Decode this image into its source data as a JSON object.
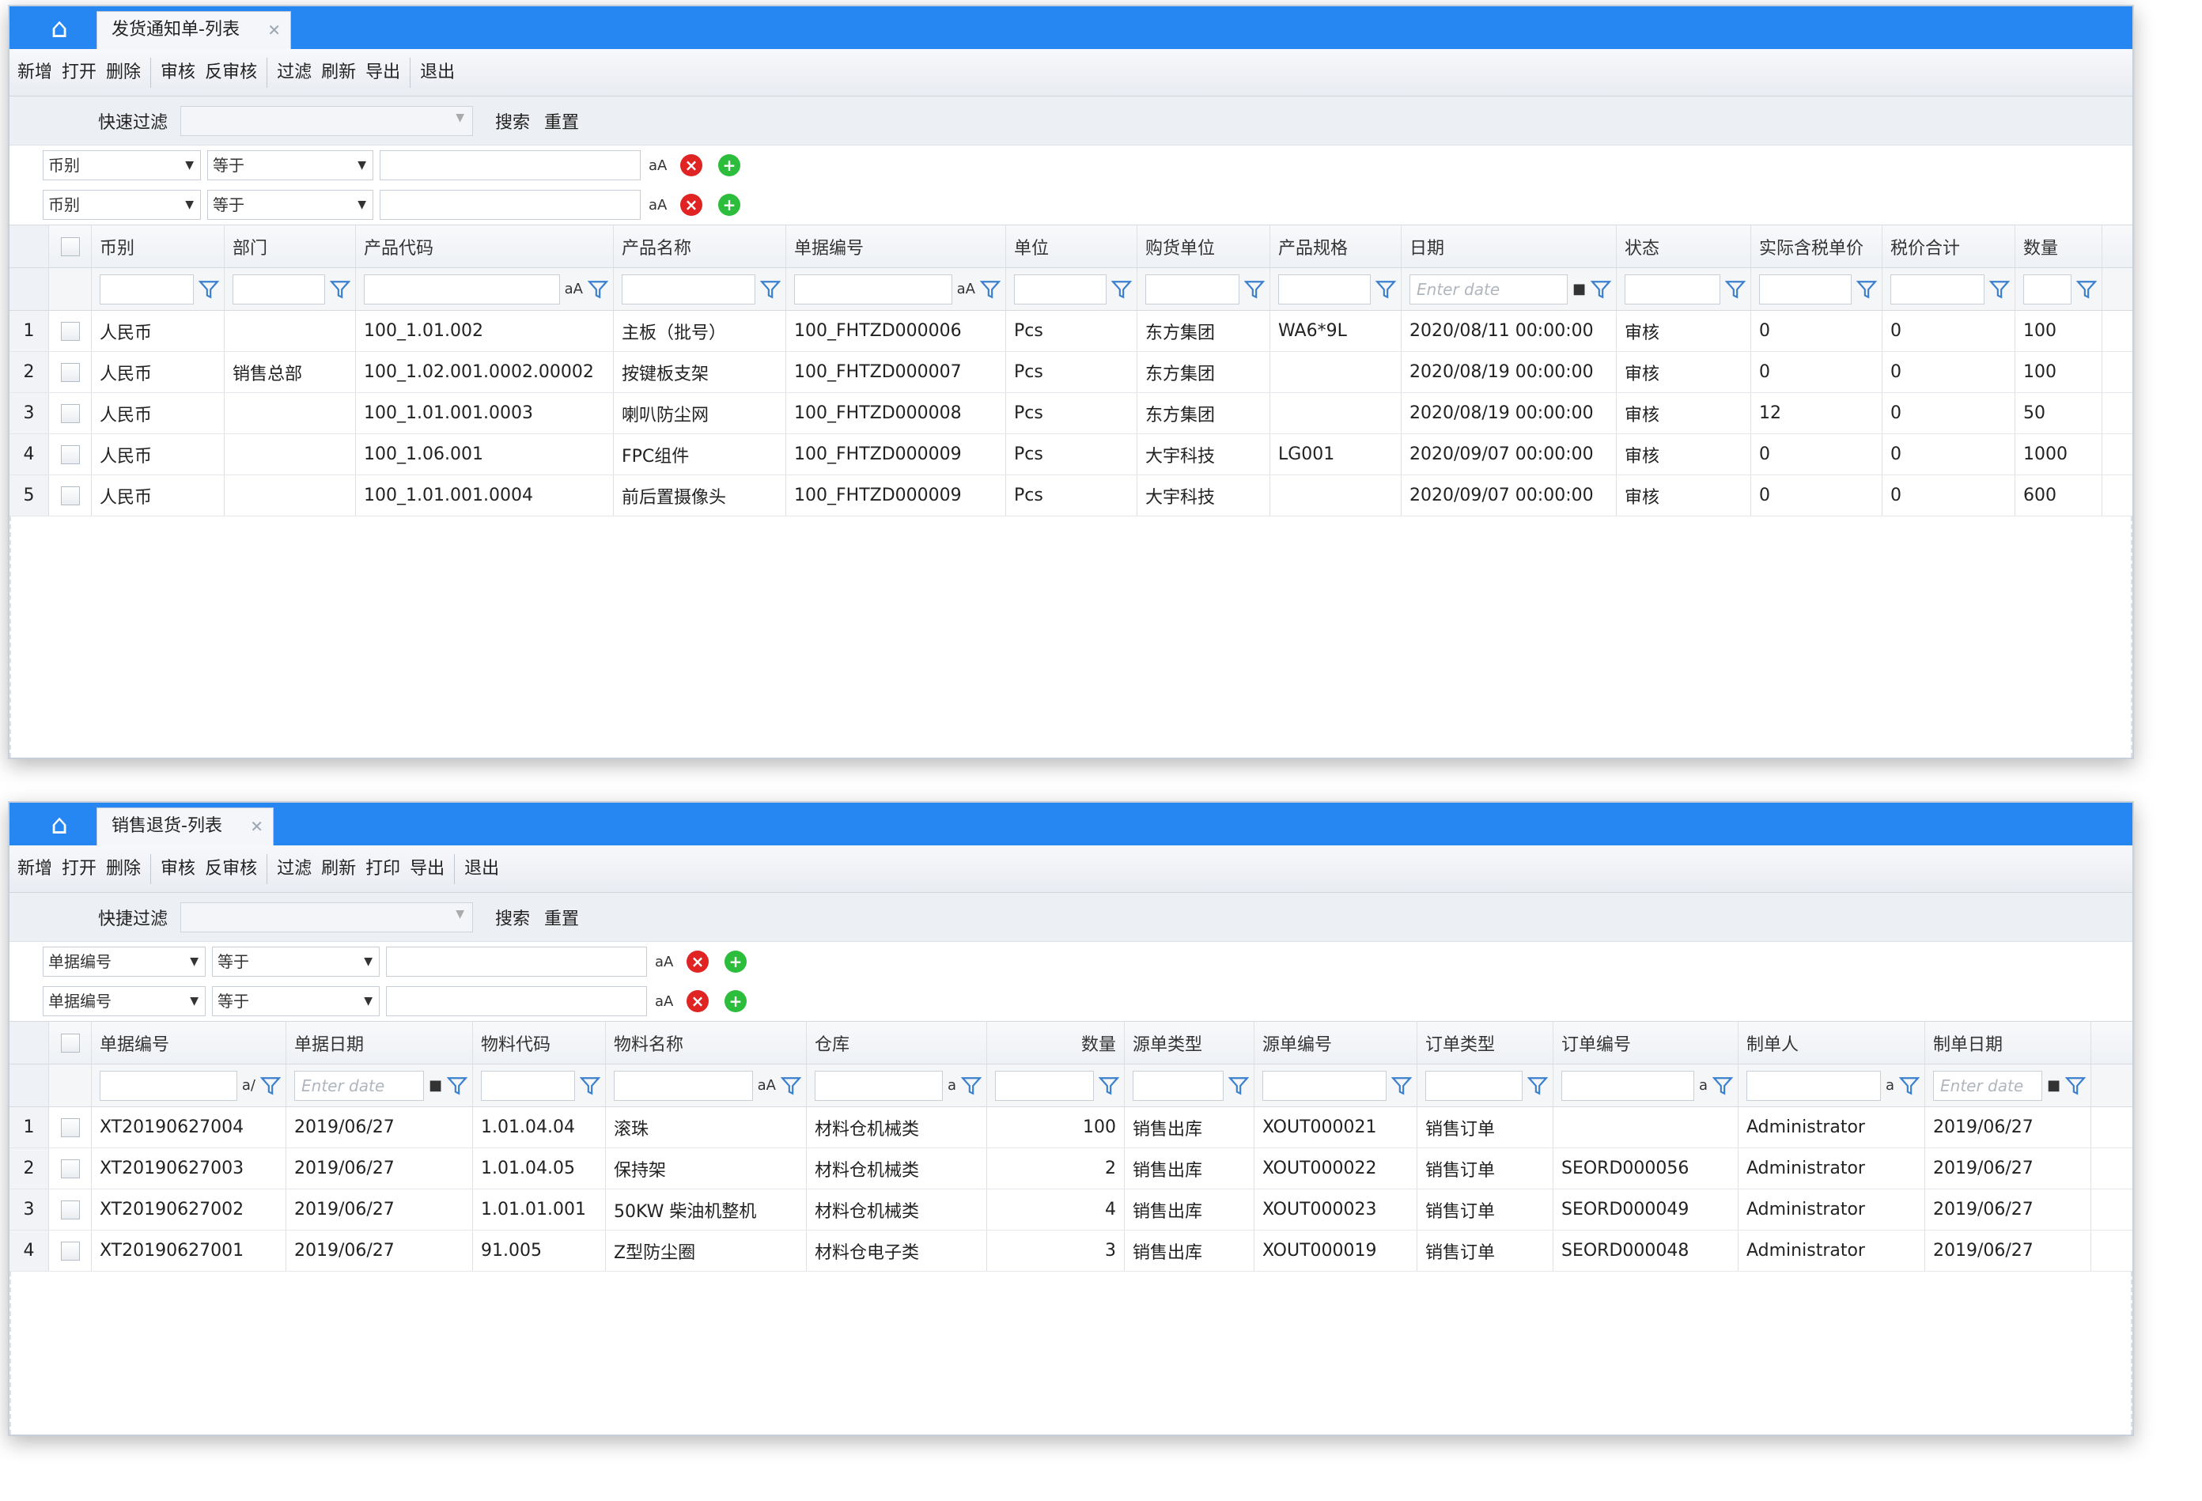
{
  "window1": {
    "tab_title": "发货通知单-列表",
    "toolbar": [
      "新增",
      "打开",
      "删除",
      "|",
      "审核",
      "反审核",
      "|",
      "过滤",
      "刷新",
      "导出",
      "|",
      "退出"
    ],
    "quick_filter": {
      "label": "快速过滤",
      "search": "搜索",
      "reset": "重置"
    },
    "filter_rows": [
      {
        "field": "币别",
        "op": "等于"
      },
      {
        "field": "币别",
        "op": "等于"
      }
    ],
    "columns": [
      "币别",
      "部门",
      "产品代码",
      "产品名称",
      "单据编号",
      "单位",
      "购货单位",
      "产品规格",
      "日期",
      "状态",
      "实际含税单价",
      "税价合计",
      "数量"
    ],
    "date_placeholder": "Enter date",
    "rows": [
      {
        "n": "1",
        "c": [
          "人民币",
          "",
          "100_1.01.002",
          "主板（批号）",
          "100_FHTZD000006",
          "Pcs",
          "东方集团",
          "WA6*9L",
          "2020/08/11 00:00:00",
          "审核",
          "0",
          "0",
          "100"
        ]
      },
      {
        "n": "2",
        "c": [
          "人民币",
          "销售总部",
          "100_1.02.001.0002.00002",
          "按键板支架",
          "100_FHTZD000007",
          "Pcs",
          "东方集团",
          "",
          "2020/08/19 00:00:00",
          "审核",
          "0",
          "0",
          "100"
        ]
      },
      {
        "n": "3",
        "c": [
          "人民币",
          "",
          "100_1.01.001.0003",
          "喇叭防尘网",
          "100_FHTZD000008",
          "Pcs",
          "东方集团",
          "",
          "2020/08/19 00:00:00",
          "审核",
          "12",
          "0",
          "50"
        ]
      },
      {
        "n": "4",
        "c": [
          "人民币",
          "",
          "100_1.06.001",
          "FPC组件",
          "100_FHTZD000009",
          "Pcs",
          "大宇科技",
          "LG001",
          "2020/09/07 00:00:00",
          "审核",
          "0",
          "0",
          "1000"
        ]
      },
      {
        "n": "5",
        "c": [
          "人民币",
          "",
          "100_1.01.001.0004",
          "前后置摄像头",
          "100_FHTZD000009",
          "Pcs",
          "大宇科技",
          "",
          "2020/09/07 00:00:00",
          "审核",
          "0",
          "0",
          "600"
        ]
      }
    ]
  },
  "window2": {
    "tab_title": "销售退货-列表",
    "toolbar": [
      "新增",
      "打开",
      "删除",
      "|",
      "审核",
      "反审核",
      "|",
      "过滤",
      "刷新",
      "打印",
      "导出",
      "|",
      "退出"
    ],
    "quick_filter": {
      "label": "快捷过滤",
      "search": "搜索",
      "reset": "重置"
    },
    "filter_rows": [
      {
        "field": "单据编号",
        "op": "等于"
      },
      {
        "field": "单据编号",
        "op": "等于"
      }
    ],
    "columns": [
      "单据编号",
      "单据日期",
      "物料代码",
      "物料名称",
      "仓库",
      "数量",
      "源单类型",
      "源单编号",
      "订单类型",
      "订单编号",
      "制单人",
      "制单日期"
    ],
    "date_placeholder": "Enter date",
    "rows": [
      {
        "n": "1",
        "c": [
          "XT20190627004",
          "2019/06/27",
          "1.01.04.04",
          "滚珠",
          "材料仓机械类",
          "100",
          "销售出库",
          "XOUT000021",
          "销售订单",
          "",
          "Administrator",
          "2019/06/27"
        ]
      },
      {
        "n": "2",
        "c": [
          "XT20190627003",
          "2019/06/27",
          "1.01.04.05",
          "保持架",
          "材料仓机械类",
          "2",
          "销售出库",
          "XOUT000022",
          "销售订单",
          "SEORD000056",
          "Administrator",
          "2019/06/27"
        ]
      },
      {
        "n": "3",
        "c": [
          "XT20190627002",
          "2019/06/27",
          "1.01.01.001",
          "50KW 柴油机整机",
          "材料仓机械类",
          "4",
          "销售出库",
          "XOUT000023",
          "销售订单",
          "SEORD000049",
          "Administrator",
          "2019/06/27"
        ]
      },
      {
        "n": "4",
        "c": [
          "XT20190627001",
          "2019/06/27",
          "91.005",
          "Z型防尘圈",
          "材料仓电子类",
          "3",
          "销售出库",
          "XOUT000019",
          "销售订单",
          "SEORD000048",
          "Administrator",
          "2019/06/27"
        ]
      }
    ]
  },
  "icons": {
    "home": "home-icon",
    "filter": "filter-icon",
    "remove": "remove-filter-icon",
    "add": "add-filter-icon",
    "close": "close-tab-icon"
  },
  "colors": {
    "titlebar": "#2787f2",
    "remove": "#e02424",
    "add": "#2dbd3c"
  }
}
